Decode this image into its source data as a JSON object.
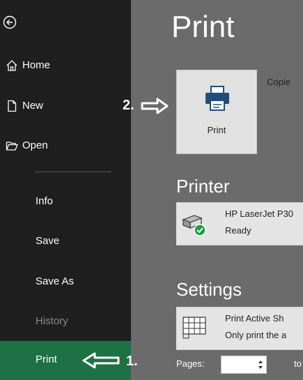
{
  "sidebar": {
    "items": [
      {
        "label": "Home",
        "icon": "home-icon"
      },
      {
        "label": "New",
        "icon": "new-document-icon"
      },
      {
        "label": "Open",
        "icon": "folder-open-icon"
      },
      {
        "label": "Info"
      },
      {
        "label": "Save"
      },
      {
        "label": "Save As"
      },
      {
        "label": "History"
      },
      {
        "label": "Print"
      }
    ],
    "back_icon": "back-arrow-icon"
  },
  "annotations": {
    "step1": "1.",
    "step2": "2."
  },
  "main": {
    "title": "Print",
    "print_button_label": "Print",
    "copies_label": "Copie",
    "printer_section": "Printer",
    "printer_name": "HP LaserJet P30",
    "printer_status": "Ready",
    "settings_section": "Settings",
    "settings_line1": "Print Active Sh",
    "settings_line2": "Only print the a",
    "pages_label": "Pages:",
    "to_label": "to"
  },
  "colors": {
    "sidebar": "#1f1f1f",
    "main": "#6b6b6b",
    "accent": "#1e7145"
  }
}
